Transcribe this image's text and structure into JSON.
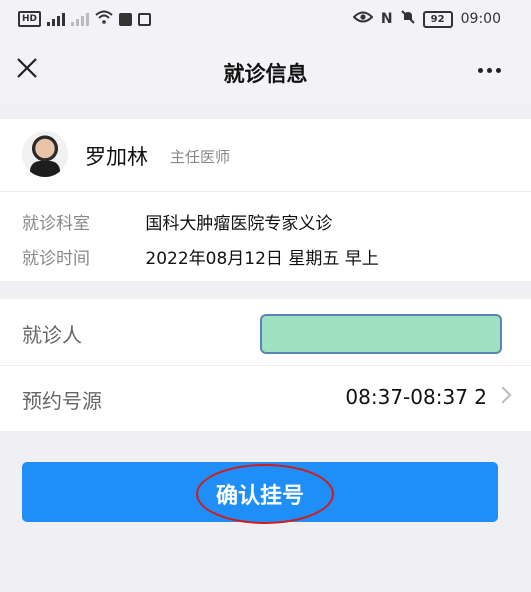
{
  "status_bar": {
    "left_badges": [
      "HD",
      "4G",
      "ᵗ",
      "◉",
      "▣"
    ],
    "battery": "92",
    "time": "09:00"
  },
  "nav": {
    "title": "就诊信息"
  },
  "doctor": {
    "name": "罗加林",
    "title": "主任医师"
  },
  "visit": {
    "dept_label": "就诊科室",
    "dept_value": "国科大肿瘤医院专家义诊",
    "time_label": "就诊时间",
    "time_value": "2022年08月12日 星期五 早上"
  },
  "form": {
    "patient_label": "就诊人",
    "patient_value": "",
    "slot_label": "预约号源",
    "slot_value": "08:37-08:37 2"
  },
  "confirm": {
    "label": "确认挂号"
  },
  "colors": {
    "primary": "#1f8ef7",
    "patient_highlight": "#9fe0c0",
    "annotation": "#d11c1c"
  }
}
